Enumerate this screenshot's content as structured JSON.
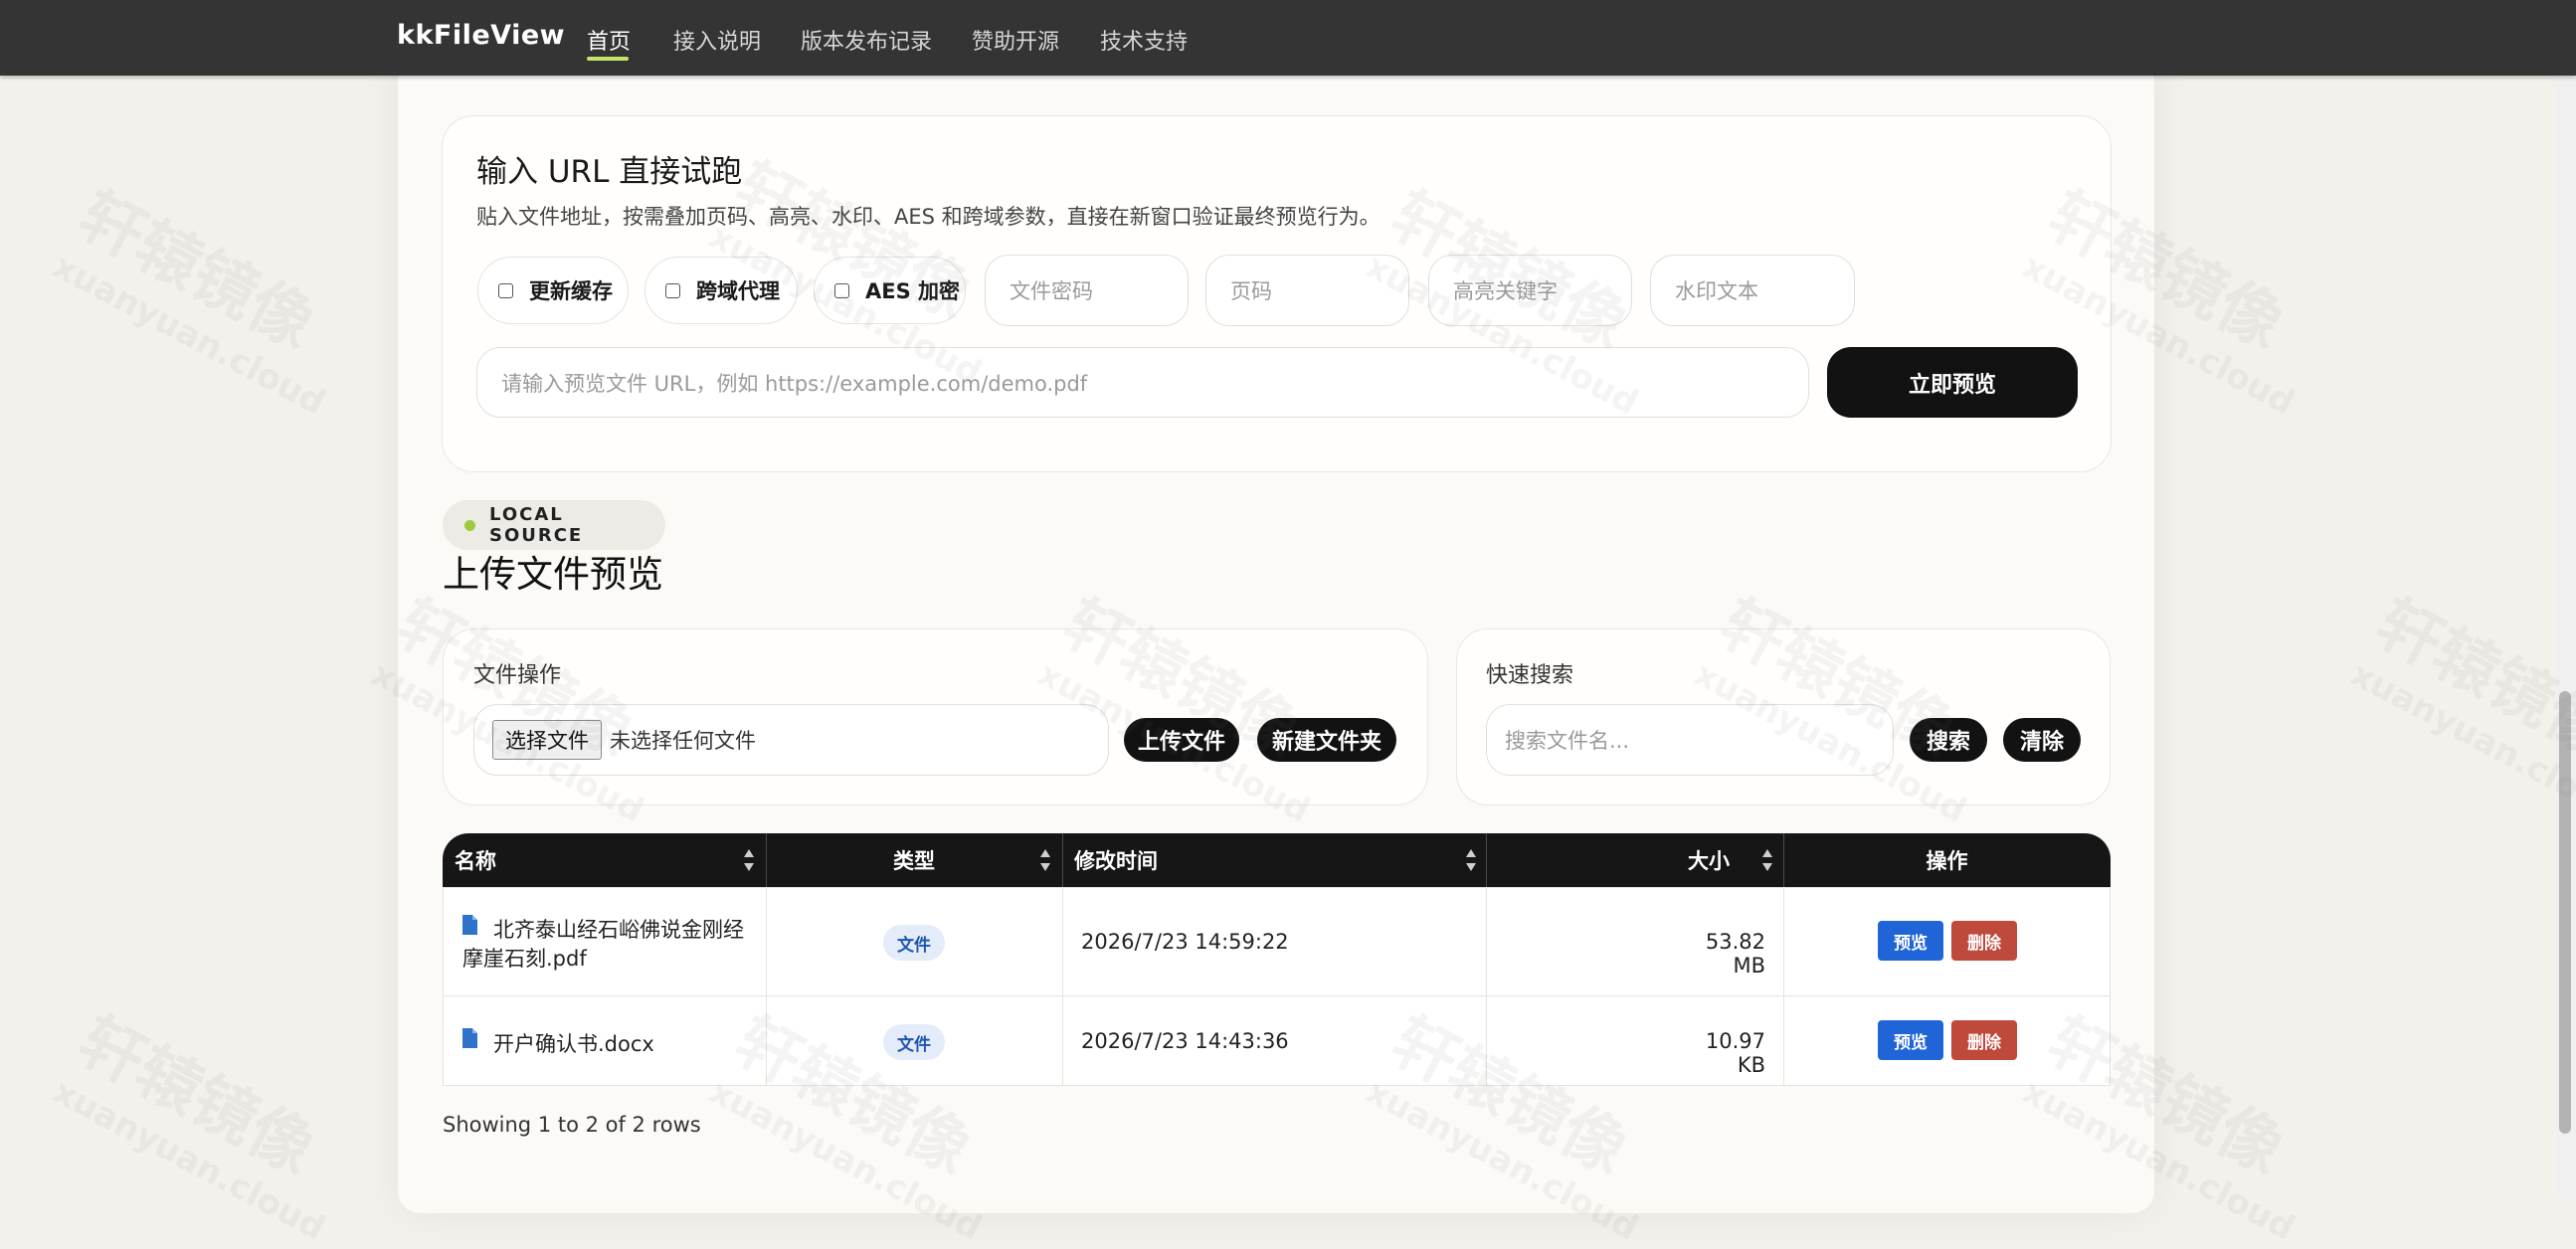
{
  "nav": {
    "brand": "kkFileView",
    "items": [
      "首页",
      "接入说明",
      "版本发布记录",
      "赞助开源",
      "技术支持"
    ]
  },
  "url_panel": {
    "title": "输入 URL 直接试跑",
    "desc": "贴入文件地址，按需叠加页码、高亮、水印、AES 和跨域参数，直接在新窗口验证最终预览行为。",
    "checkboxes": [
      "更新缓存",
      "跨域代理",
      "AES 加密"
    ],
    "placeholders": {
      "password": "文件密码",
      "page": "页码",
      "highlight": "高亮关键字",
      "watermark": "水印文本",
      "url": "请输入预览文件 URL，例如 https://example.com/demo.pdf"
    },
    "preview_button": "立即预览"
  },
  "local": {
    "badge": "LOCAL SOURCE",
    "title": "上传文件预览",
    "file_ops_label": "文件操作",
    "choose_file": "选择文件",
    "no_file": "未选择任何文件",
    "upload_button": "上传文件",
    "new_folder_button": "新建文件夹",
    "search_label": "快速搜索",
    "search_placeholder": "搜索文件名...",
    "search_button": "搜索",
    "clear_button": "清除"
  },
  "table": {
    "headers": [
      "名称",
      "类型",
      "修改时间",
      "大小",
      "操作"
    ],
    "rows": [
      {
        "name_line1": "北齐泰山经石峪佛说金刚经",
        "name_line2": "摩崖石刻.pdf",
        "type": "文件",
        "modified": "2026/7/23 14:59:22",
        "size": "53.82 MB",
        "preview": "预览",
        "delete": "删除"
      },
      {
        "name_line1": "开户确认书.docx",
        "name_line2": "",
        "type": "文件",
        "modified": "2026/7/23 14:43:36",
        "size": "10.97 KB",
        "preview": "预览",
        "delete": "删除"
      }
    ],
    "footer": "Showing 1 to 2 of 2 rows"
  },
  "watermark": {
    "big": "轩辕镜像",
    "small": "xuanyuan.cloud"
  },
  "colors": {
    "accent": "#c7e46a",
    "dark": "#121212",
    "blue": "#2065d8",
    "red": "#bf4a3c"
  }
}
